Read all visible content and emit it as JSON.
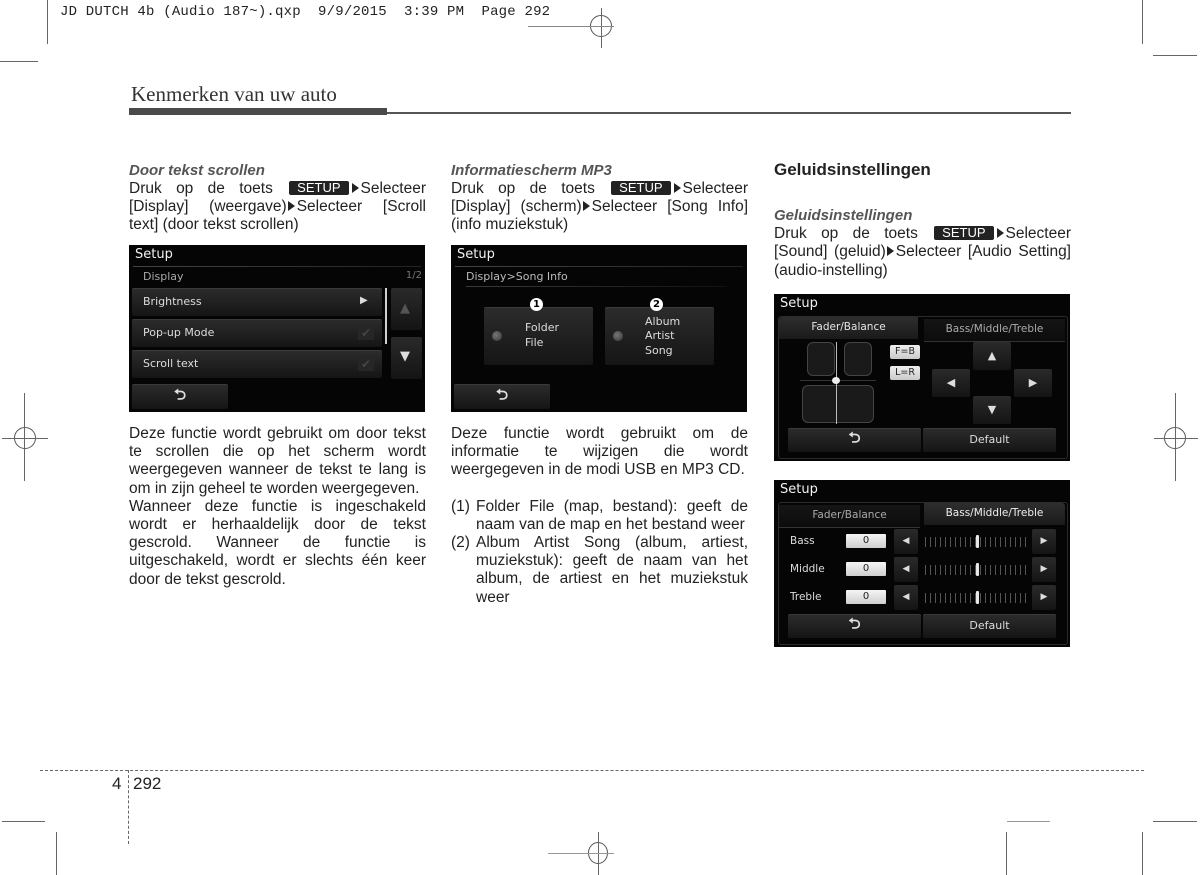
{
  "print_slug": "JD DUTCH 4b (Audio 187~).qxp  9/9/2015  3:39 PM  Page 292",
  "header": {
    "title": "Kenmerken van uw auto"
  },
  "columns": {
    "left": {
      "subheading": "Door tekst scrollen",
      "instruction": {
        "prefix": "Druk op de toets",
        "key": "SETUP",
        "step1": "Selecteer [Display] (weergave)",
        "step2": "Selecteer [Scroll text] (door tekst scrollen)"
      },
      "screen": {
        "title": "Setup",
        "breadcrumb": "Display",
        "page_indicator": "1/2",
        "items": [
          {
            "label": "Brightness",
            "control": "arrow-right"
          },
          {
            "label": "Pop-up Mode",
            "control": "checkbox"
          },
          {
            "label": "Scroll text",
            "control": "checkbox"
          }
        ],
        "back_glyph": "⮌"
      },
      "paragraphs": [
        "Deze functie wordt gebruikt om door tekst te scrollen die op het scherm wordt weergegeven wanneer de tekst te lang is om in zijn geheel te worden weergegeven.",
        "Wanneer deze functie is ingeschakeld wordt er herhaaldelijk door de tekst gescrold. Wanneer de functie is uitgeschakeld, wordt er slechts één keer door de tekst gescrold."
      ]
    },
    "middle": {
      "subheading": "Informatiescherm MP3",
      "instruction": {
        "prefix": "Druk op de toets",
        "key": "SETUP",
        "step1": "Selecteer [Display] (scherm)",
        "step2": "Selecteer [Song Info] (info muziekstuk)"
      },
      "screen": {
        "title": "Setup",
        "breadcrumb": "Display>Song Info",
        "options": [
          {
            "marker": "1",
            "lines": [
              "Folder",
              "File"
            ]
          },
          {
            "marker": "2",
            "lines": [
              "Album",
              "Artist",
              "Song"
            ]
          }
        ],
        "back_glyph": "⮌"
      },
      "paragraph": "Deze functie wordt gebruikt om de informatie te wijzigen die wordt weergegeven in de modi USB en MP3 CD.",
      "list": [
        {
          "num": "(1)",
          "text": "Folder File (map, bestand): geeft de naam van de map en het bestand weer"
        },
        {
          "num": "(2)",
          "text": "Album Artist Song (album, artiest, muziekstuk): geeft de naam van het album, de artiest en het muziekstuk weer"
        }
      ]
    },
    "right": {
      "section_heading": "Geluidsinstellingen",
      "subheading": "Geluidsinstellingen",
      "instruction": {
        "prefix": "Druk op de toets",
        "key": "SETUP",
        "step1": "Selecteer [Sound] (geluid)",
        "step2": "Selecteer [Audio Setting] (audio-instelling)"
      },
      "screen_fader": {
        "title": "Setup",
        "tabs": [
          "Fader/Balance",
          "Bass/Middle/Treble"
        ],
        "active_tab": 0,
        "presets": [
          "F=B",
          "L=R"
        ],
        "arrows": {
          "up": "▲",
          "down": "▼",
          "left": "◀",
          "right": "▶"
        },
        "back_glyph": "⮌",
        "default_label": "Default"
      },
      "screen_tone": {
        "title": "Setup",
        "tabs": [
          "Fader/Balance",
          "Bass/Middle/Treble"
        ],
        "active_tab": 1,
        "rows": [
          {
            "label": "Bass",
            "value": "0",
            "level": 0.5
          },
          {
            "label": "Middle",
            "value": "0",
            "level": 0.5
          },
          {
            "label": "Treble",
            "value": "0",
            "level": 0.5
          }
        ],
        "arrow_left": "◀",
        "arrow_right": "▶",
        "back_glyph": "⮌",
        "default_label": "Default"
      }
    }
  },
  "footer": {
    "chapter": "4",
    "page": "292"
  }
}
